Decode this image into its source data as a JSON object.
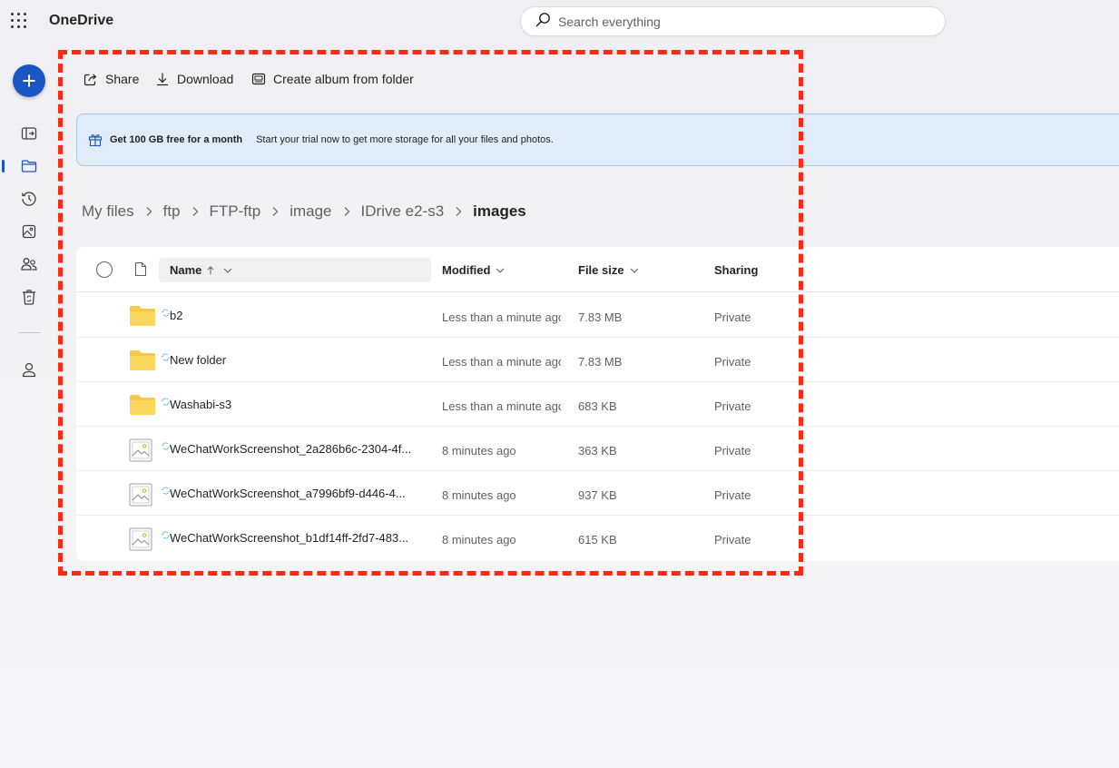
{
  "app": {
    "title": "OneDrive"
  },
  "search": {
    "placeholder": "Search everything"
  },
  "commands": {
    "share": "Share",
    "download": "Download",
    "create_album": "Create album from folder"
  },
  "banner": {
    "title": "Get 100 GB free for a month",
    "text": "Start your trial now to get more storage for all your files and photos."
  },
  "breadcrumb": [
    "My files",
    "ftp",
    "FTP-ftp",
    "image",
    "IDrive e2-s3",
    "images"
  ],
  "columns": {
    "name": "Name",
    "modified": "Modified",
    "size": "File size",
    "sharing": "Sharing"
  },
  "files": [
    {
      "name": "b2",
      "type": "folder",
      "modified": "Less than a minute ago",
      "size": "7.83 MB",
      "sharing": "Private"
    },
    {
      "name": "New folder",
      "type": "folder",
      "modified": "Less than a minute ago",
      "size": "7.83 MB",
      "sharing": "Private"
    },
    {
      "name": "Washabi-s3",
      "type": "folder",
      "modified": "Less than a minute ago",
      "size": "683 KB",
      "sharing": "Private"
    },
    {
      "name": "WeChatWorkScreenshot_2a286b6c-2304-4f...",
      "type": "image",
      "modified": "8 minutes ago",
      "size": "363 KB",
      "sharing": "Private"
    },
    {
      "name": "WeChatWorkScreenshot_a7996bf9-d446-4...",
      "type": "image",
      "modified": "8 minutes ago",
      "size": "937 KB",
      "sharing": "Private"
    },
    {
      "name": "WeChatWorkScreenshot_b1df14ff-2fd7-483...",
      "type": "image",
      "modified": "8 minutes ago",
      "size": "615 KB",
      "sharing": "Private"
    }
  ],
  "colors": {
    "accent": "#1a56c4",
    "highlight": "#ff2a12",
    "folder": "#f7c948",
    "banner_bg": "#e1ecf9"
  }
}
